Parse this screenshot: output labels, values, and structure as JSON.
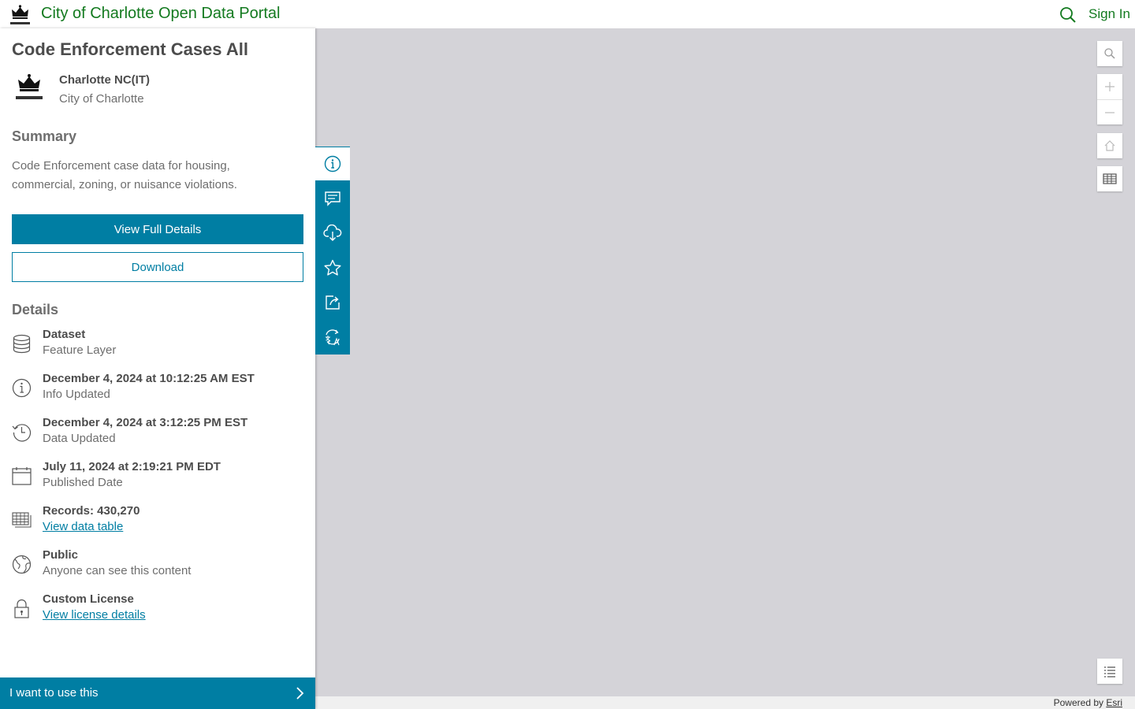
{
  "header": {
    "site_title": "City of Charlotte Open Data Portal",
    "sign_in": "Sign In"
  },
  "panel": {
    "title": "Code Enforcement Cases All",
    "owner_name": "Charlotte NC(IT)",
    "owner_org": "City of Charlotte",
    "summary_heading": "Summary",
    "summary_text": "Code Enforcement case data for housing, commercial, zoning, or nuisance violations.",
    "view_details_label": "View Full Details",
    "download_label": "Download",
    "details_heading": "Details",
    "details": [
      {
        "main": "Dataset",
        "sub": "Feature Layer",
        "icon": "database-icon"
      },
      {
        "main": "December 4, 2024 at 10:12:25 AM EST",
        "sub": "Info Updated",
        "icon": "info-icon"
      },
      {
        "main": "December 4, 2024 at 3:12:25 PM EST",
        "sub": "Data Updated",
        "icon": "history-icon"
      },
      {
        "main": "July 11, 2024 at 2:19:21 PM EDT",
        "sub": "Published Date",
        "icon": "calendar-icon"
      },
      {
        "main": "Records: 430,270",
        "link": "View data table",
        "icon": "table-icon"
      },
      {
        "main": "Public",
        "sub": "Anyone can see this content",
        "icon": "globe-icon"
      },
      {
        "main": "Custom License",
        "link": "View license details",
        "icon": "lock-icon"
      }
    ],
    "use_bar_label": "I want to use this"
  },
  "tabs": [
    "info-icon",
    "comment-icon",
    "cloud-download-icon",
    "star-icon",
    "share-icon",
    "translate-icon"
  ],
  "attribution": {
    "powered_by": "Powered by ",
    "esri": "Esri"
  },
  "colors": {
    "brand_green": "#137a1f",
    "accent_blue": "#007ea3",
    "map_bg": "#d4d3d8"
  }
}
